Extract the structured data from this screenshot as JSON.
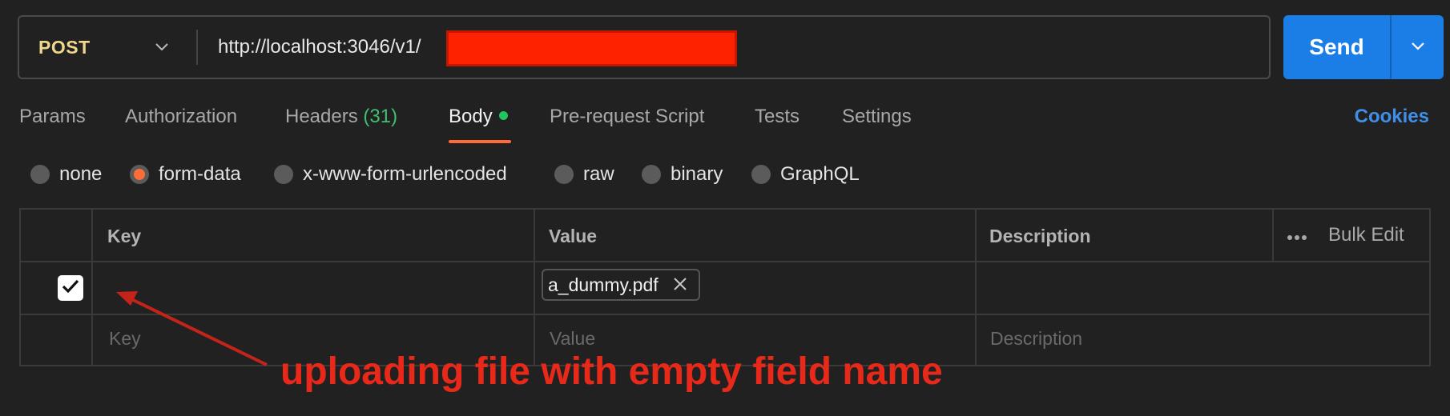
{
  "request": {
    "method": "POST",
    "url": "http://localhost:3046/v1/"
  },
  "send": {
    "label": "Send"
  },
  "tabs": [
    {
      "label": "Params"
    },
    {
      "label": "Authorization"
    },
    {
      "label": "Headers",
      "count": "(31)"
    },
    {
      "label": "Body"
    },
    {
      "label": "Pre-request Script"
    },
    {
      "label": "Tests"
    },
    {
      "label": "Settings"
    }
  ],
  "cookies_label": "Cookies",
  "body_types": [
    {
      "label": "none",
      "selected": false
    },
    {
      "label": "form-data",
      "selected": true
    },
    {
      "label": "x-www-form-urlencoded",
      "selected": false
    },
    {
      "label": "raw",
      "selected": false
    },
    {
      "label": "binary",
      "selected": false
    },
    {
      "label": "GraphQL",
      "selected": false
    }
  ],
  "table": {
    "headers": {
      "key": "Key",
      "value": "Value",
      "description": "Description"
    },
    "bulk_edit": "Bulk Edit",
    "row": {
      "checked": true,
      "key": "",
      "file": "a_dummy.pdf",
      "description": ""
    },
    "placeholders": {
      "key": "Key",
      "value": "Value",
      "description": "Description"
    }
  },
  "annotation": "uploading file with empty field name",
  "colors": {
    "accent_orange": "#ff6c37",
    "send_blue": "#1b7ee6",
    "method_yellow": "#f0d88a",
    "annotation_red": "#e8291a",
    "redaction_red": "#ff2200"
  },
  "icons": [
    "chevron-down-icon",
    "close-icon",
    "more-dots-icon",
    "checkmark-icon",
    "arrow-annotation"
  ]
}
